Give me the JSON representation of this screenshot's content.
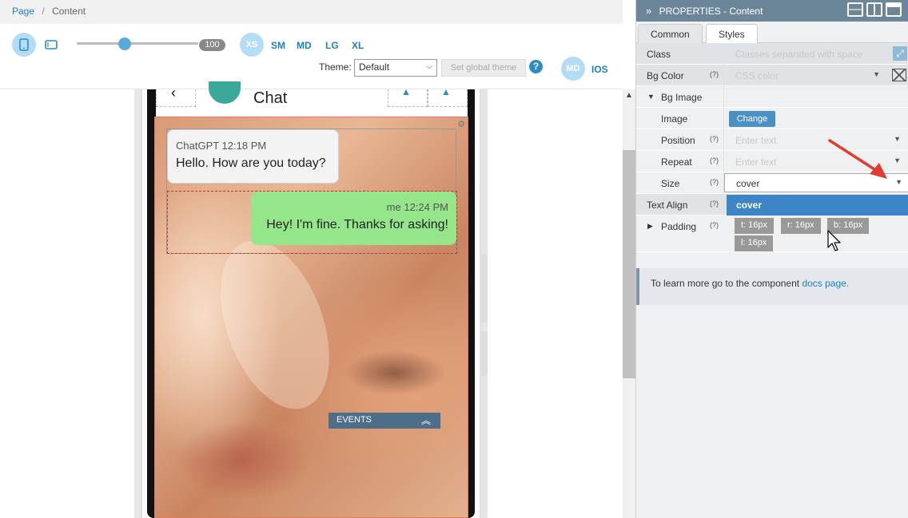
{
  "breadcrumb": {
    "page": "Page",
    "separator": "/",
    "current": "Content"
  },
  "toolbar": {
    "zoom": 100,
    "zoom_fraction": 0.38,
    "breakpoints": [
      "XS",
      "SM",
      "MD",
      "LG",
      "XL"
    ],
    "theme_label": "Theme:",
    "theme_value": "Default",
    "set_global_theme": "Set global theme",
    "help": "?",
    "platform_md": "MD",
    "platform_ios": "IOS"
  },
  "preview": {
    "chat_title": "Chat",
    "incoming": {
      "meta": "ChatGPT 12:18 PM",
      "text": "Hello. How are you today?"
    },
    "outgoing": {
      "meta": "me 12:24 PM",
      "text": "Hey! I'm fine. Thanks for asking!"
    },
    "events_label": "EVENTS"
  },
  "panel": {
    "title": "PROPERTIES - Content",
    "tabs": {
      "common": "Common",
      "styles": "Styles"
    },
    "rows": {
      "class": {
        "label": "Class",
        "placeholder": "Classes separated with space"
      },
      "bg_color": {
        "label": "Bg Color",
        "hint": "(?)",
        "placeholder": "CSS color"
      },
      "bg_image": {
        "label": "Bg Image"
      },
      "image": {
        "label": "Image",
        "button": "Change"
      },
      "position": {
        "label": "Position",
        "hint": "(?)",
        "placeholder": "Enter text"
      },
      "repeat": {
        "label": "Repeat",
        "hint": "(?)",
        "placeholder": "Enter text"
      },
      "size": {
        "label": "Size",
        "hint": "(?)",
        "value": "cover",
        "option": "cover"
      },
      "text_align": {
        "label": "Text Align",
        "hint": "(?)"
      },
      "padding": {
        "label": "Padding",
        "hint": "(?)",
        "top": "t: 16px",
        "right": "r: 16px",
        "bottom": "b: 16px",
        "left": "l: 16px"
      }
    },
    "info": {
      "text": "To learn more go to the component ",
      "link": "docs page."
    }
  },
  "colors": {
    "accent": "#1e7fbf",
    "panel_header": "#6c8699",
    "selected_option": "#3d85c6",
    "outgoing_bubble": "#95e68b",
    "arrow": "#e03c31"
  }
}
